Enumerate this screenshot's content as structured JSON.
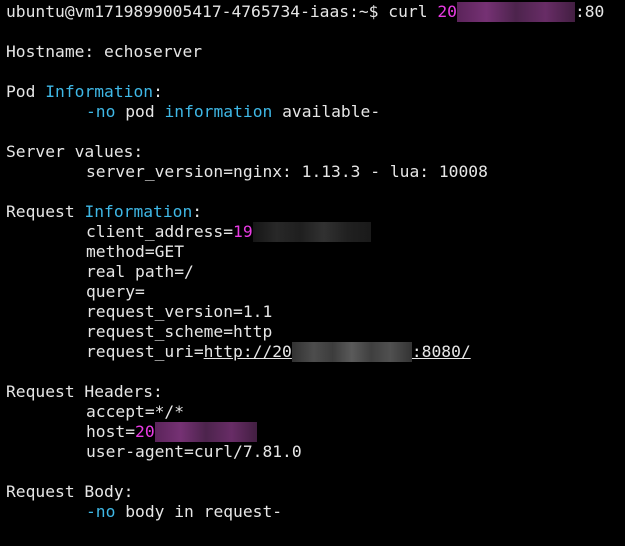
{
  "prompt": {
    "user_host": "ubuntu@vm1719899005417-4765734-iaas:~$",
    "command": "curl",
    "url_start": "20",
    "url_end": ":80"
  },
  "hostname": {
    "label": "Hostname:",
    "value": "echoserver"
  },
  "pod": {
    "heading_word": "Pod",
    "heading_kw": "Information",
    "heading_colon": ":",
    "line_dash": "-no",
    "line_mid": "pod",
    "line_kw": "information",
    "line_end": "available-"
  },
  "server": {
    "heading": "Server values:",
    "value": "server_version=nginx: 1.13.3 - lua: 10008"
  },
  "request_info": {
    "heading_word": "Request",
    "heading_kw": "Information",
    "heading_colon": ":",
    "client_address_label": "client_address=",
    "client_address_value": "19",
    "method": "method=GET",
    "real_path": "real path=/",
    "query": "query=",
    "request_version": "request_version=1.1",
    "request_scheme": "request_scheme=http",
    "request_uri_label": "request_uri=",
    "request_uri_start": "http://20",
    "request_uri_end": ":8080/"
  },
  "request_headers": {
    "heading": "Request Headers:",
    "accept": "accept=*/*",
    "host_label": "host=",
    "host_value": "20",
    "user_agent": "user-agent=curl/7.81.0"
  },
  "request_body": {
    "heading": "Request Body:",
    "line_dash": "-no",
    "line_end": "body in request-"
  },
  "colors": {
    "background": "#000000",
    "text": "#e6e6e6",
    "keyword": "#3fb8e6",
    "magenta": "#e93be4"
  }
}
